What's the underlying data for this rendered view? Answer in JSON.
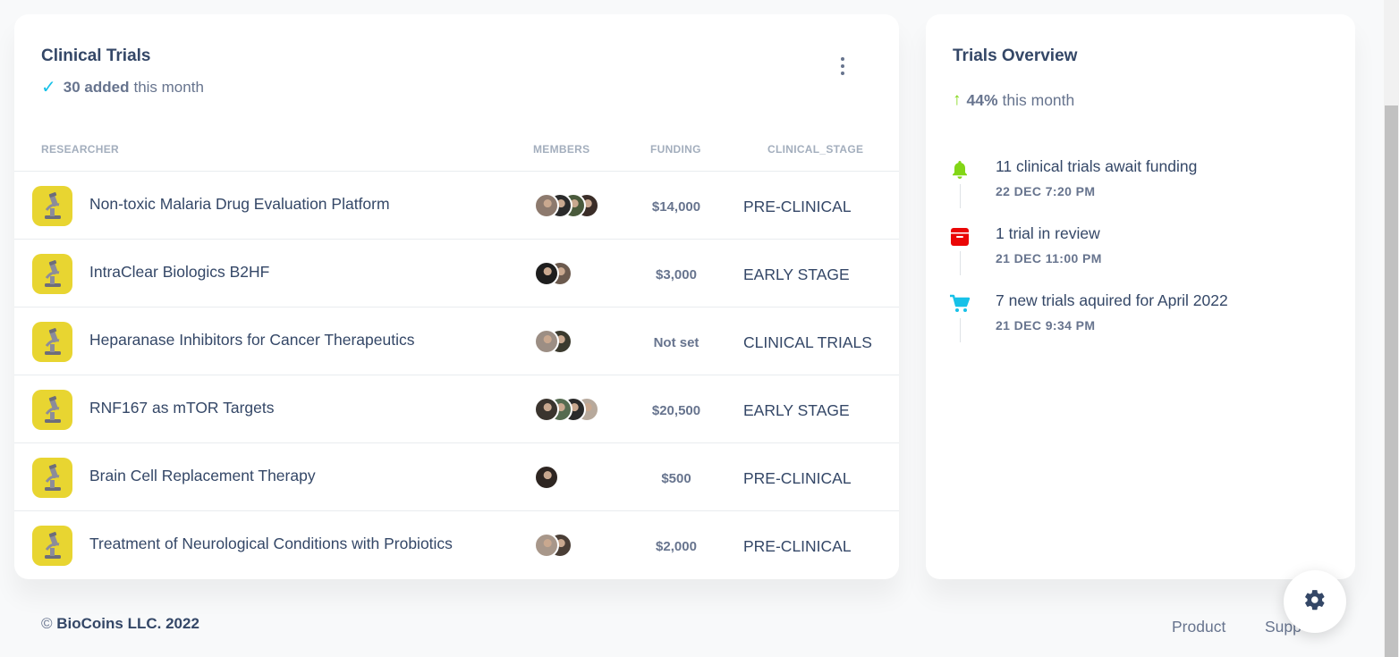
{
  "trials": {
    "title": "Clinical Trials",
    "added_count": "30 added",
    "added_suffix": "this month",
    "columns": [
      "RESEARCHER",
      "MEMBERS",
      "FUNDING",
      "CLINICAL_STAGE"
    ],
    "rows": [
      {
        "name": "Non-toxic Malaria Drug Evaluation Platform",
        "funding": "$14,000",
        "stage": "PRE-CLINICAL",
        "icon": "microscope-icon",
        "members": 4
      },
      {
        "name": "IntraClear Biologics B2HF",
        "funding": "$3,000",
        "stage": "EARLY STAGE",
        "icon": "microscope-icon",
        "members": 2
      },
      {
        "name": "Heparanase Inhibitors for Cancer Therapeutics",
        "funding": "Not set",
        "stage": "CLINICAL TRIALS",
        "icon": "microscope-icon",
        "members": 2
      },
      {
        "name": "RNF167 as mTOR Targets",
        "funding": "$20,500",
        "stage": "EARLY STAGE",
        "icon": "microscope-icon",
        "members": 4
      },
      {
        "name": "Brain Cell Replacement Therapy",
        "funding": "$500",
        "stage": "PRE-CLINICAL",
        "icon": "microscope-icon",
        "members": 1
      },
      {
        "name": "Treatment of Neurological Conditions with Probiotics",
        "funding": "$2,000",
        "stage": "PRE-CLINICAL",
        "icon": "microscope-icon",
        "members": 2
      }
    ]
  },
  "overview": {
    "title": "Trials Overview",
    "percent": "44%",
    "percent_suffix": "this month",
    "items": [
      {
        "text": "11 clinical trials await funding",
        "date": "22 DEC 7:20 PM",
        "icon": "bell-icon",
        "color": "#82d616"
      },
      {
        "text": "1 trial in review",
        "date": "21 DEC 11:00 PM",
        "icon": "archive-icon",
        "color": "#ea0606"
      },
      {
        "text": "7 new trials aquired for April 2022",
        "date": "21 DEC 9:34 PM",
        "icon": "cart-icon",
        "color": "#17c1e8"
      }
    ]
  },
  "footer": {
    "copyright_symbol": "©",
    "company": "BioCoins LLC. 2022",
    "links": [
      "Product",
      "Supp"
    ]
  },
  "colors": {
    "accent_check": "#17c1e8",
    "arrow_up": "#82d616",
    "logo_bg": "#e8d531"
  }
}
